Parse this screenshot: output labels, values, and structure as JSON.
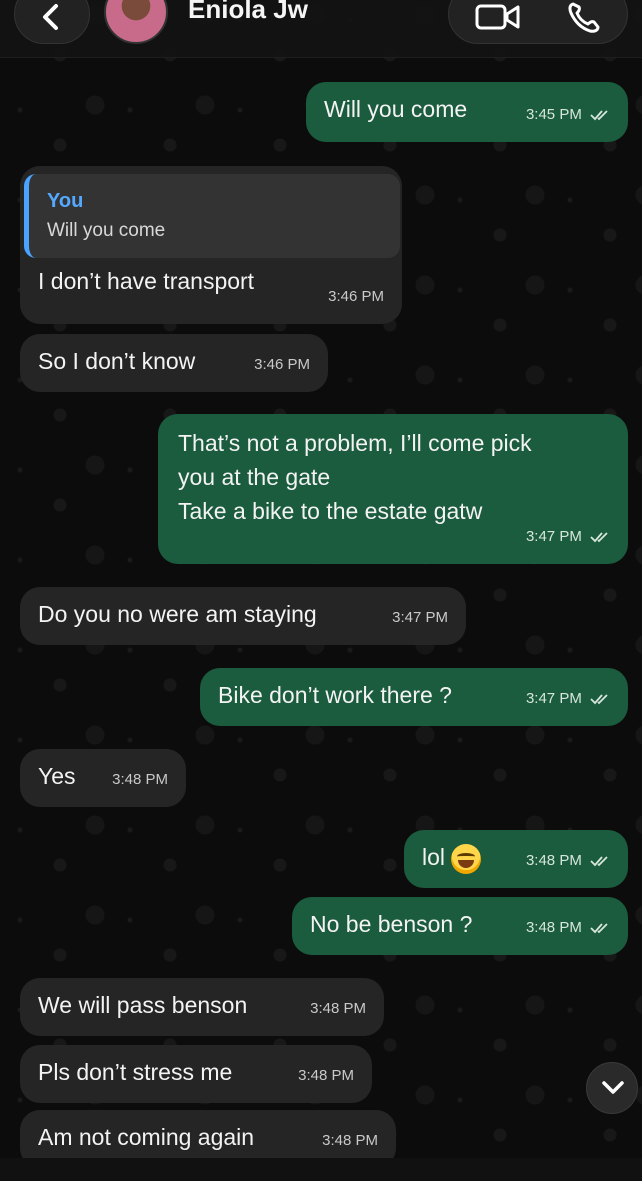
{
  "header": {
    "contact_name": "Eniola Jw"
  },
  "messages": [
    {
      "dir": "out",
      "text": "Will you come",
      "time": "3:45 PM",
      "read": true
    },
    {
      "dir": "in",
      "quote_author": "You",
      "quote_text": "Will you come",
      "text": "I don’t have transport",
      "time": "3:46 PM"
    },
    {
      "dir": "in",
      "text": "So I don’t know",
      "time": "3:46 PM"
    },
    {
      "dir": "out",
      "lines": [
        "That’s not a problem, I’ll come pick",
        "you at the gate",
        "Take a bike to the estate gatw"
      ],
      "time": "3:47 PM",
      "read": true
    },
    {
      "dir": "in",
      "text": "Do you no were am staying",
      "time": "3:47 PM"
    },
    {
      "dir": "out",
      "text": "Bike don’t work there ?",
      "time": "3:47 PM",
      "read": true
    },
    {
      "dir": "in",
      "text": "Yes",
      "time": "3:48 PM"
    },
    {
      "dir": "out",
      "text": "lol",
      "emoji": "face-with-tears-of-joy",
      "time": "3:48 PM",
      "read": true
    },
    {
      "dir": "out",
      "text": "No be benson ?",
      "time": "3:48 PM",
      "read": true
    },
    {
      "dir": "in",
      "text": "We will pass benson",
      "time": "3:48 PM"
    },
    {
      "dir": "in",
      "text": "Pls don’t stress me",
      "time": "3:48 PM"
    },
    {
      "dir": "in",
      "text": "Am not coming again",
      "time": "3:48 PM"
    }
  ],
  "icons": {
    "back": "chevron-left-icon",
    "video": "video-camera-icon",
    "phone": "phone-icon",
    "scroll": "chevron-down-icon",
    "read_receipt": "double-check-icon"
  },
  "colors": {
    "outgoing_bubble": "#1b5b3e",
    "incoming_bubble": "#252525",
    "quote_author": "#55a8ff",
    "background": "#0c0c0c"
  }
}
